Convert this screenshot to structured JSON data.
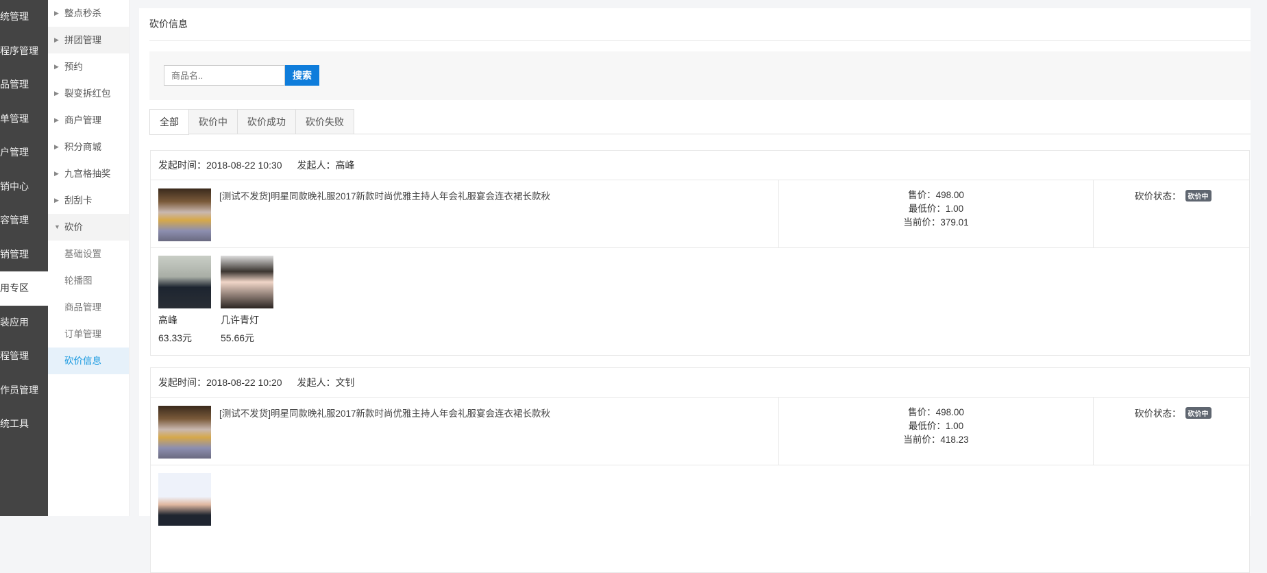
{
  "rail": [
    "统管理",
    "程序管理",
    "品管理",
    "单管理",
    "户管理",
    "销中心",
    "容管理",
    "销管理",
    "用专区",
    "装应用",
    "程管理",
    "作员管理",
    "统工具"
  ],
  "submenu": [
    {
      "label": "整点秒杀",
      "type": "collapsed"
    },
    {
      "label": "拼团管理",
      "type": "collapsed"
    },
    {
      "label": "预约",
      "type": "collapsed"
    },
    {
      "label": "裂变拆红包",
      "type": "collapsed"
    },
    {
      "label": "商户管理",
      "type": "collapsed"
    },
    {
      "label": "积分商城",
      "type": "collapsed"
    },
    {
      "label": "九宫格抽奖",
      "type": "collapsed"
    },
    {
      "label": "刮刮卡",
      "type": "collapsed"
    },
    {
      "label": "砍价",
      "type": "open"
    },
    {
      "label": "基础设置",
      "type": "child"
    },
    {
      "label": "轮播图",
      "type": "child"
    },
    {
      "label": "商品管理",
      "type": "child"
    },
    {
      "label": "订单管理",
      "type": "child"
    },
    {
      "label": "砍价信息",
      "type": "active"
    }
  ],
  "page": {
    "title": "砍价信息"
  },
  "search": {
    "placeholder": "商品名..",
    "button": "搜索"
  },
  "tabs": [
    "全部",
    "砍价中",
    "砍价成功",
    "砍价失败"
  ],
  "labels": {
    "start_time": "发起时间：",
    "initiator": "发起人：",
    "sale_price": "售价：",
    "min_price": "最低价：",
    "current_price": "当前价：",
    "status": "砍价状态："
  },
  "records": [
    {
      "time": "2018-08-22 10:30",
      "initiator": "高峰",
      "product": "[测试不发货]明星同款晚礼服2017新款时尚优雅主持人年会礼服宴会连衣裙长款秋",
      "sale_price": "498.00",
      "min_price": "1.00",
      "current_price": "379.01",
      "status": "砍价中",
      "helpers": [
        {
          "name": "高峰",
          "amount": "63.33元"
        },
        {
          "name": "几许青灯",
          "amount": "55.66元"
        }
      ]
    },
    {
      "time": "2018-08-22 10:20",
      "initiator": "文钊",
      "product": "[测试不发货]明星同款晚礼服2017新款时尚优雅主持人年会礼服宴会连衣裙长款秋",
      "sale_price": "498.00",
      "min_price": "1.00",
      "current_price": "418.23",
      "status": "砍价中",
      "helpers": [
        {
          "name": "",
          "amount": ""
        }
      ]
    }
  ],
  "colors": {
    "rail_bg": "#444444",
    "accent": "#0f7ddb",
    "active_sub": "#1a9ae0",
    "badge": "#5f6670"
  }
}
